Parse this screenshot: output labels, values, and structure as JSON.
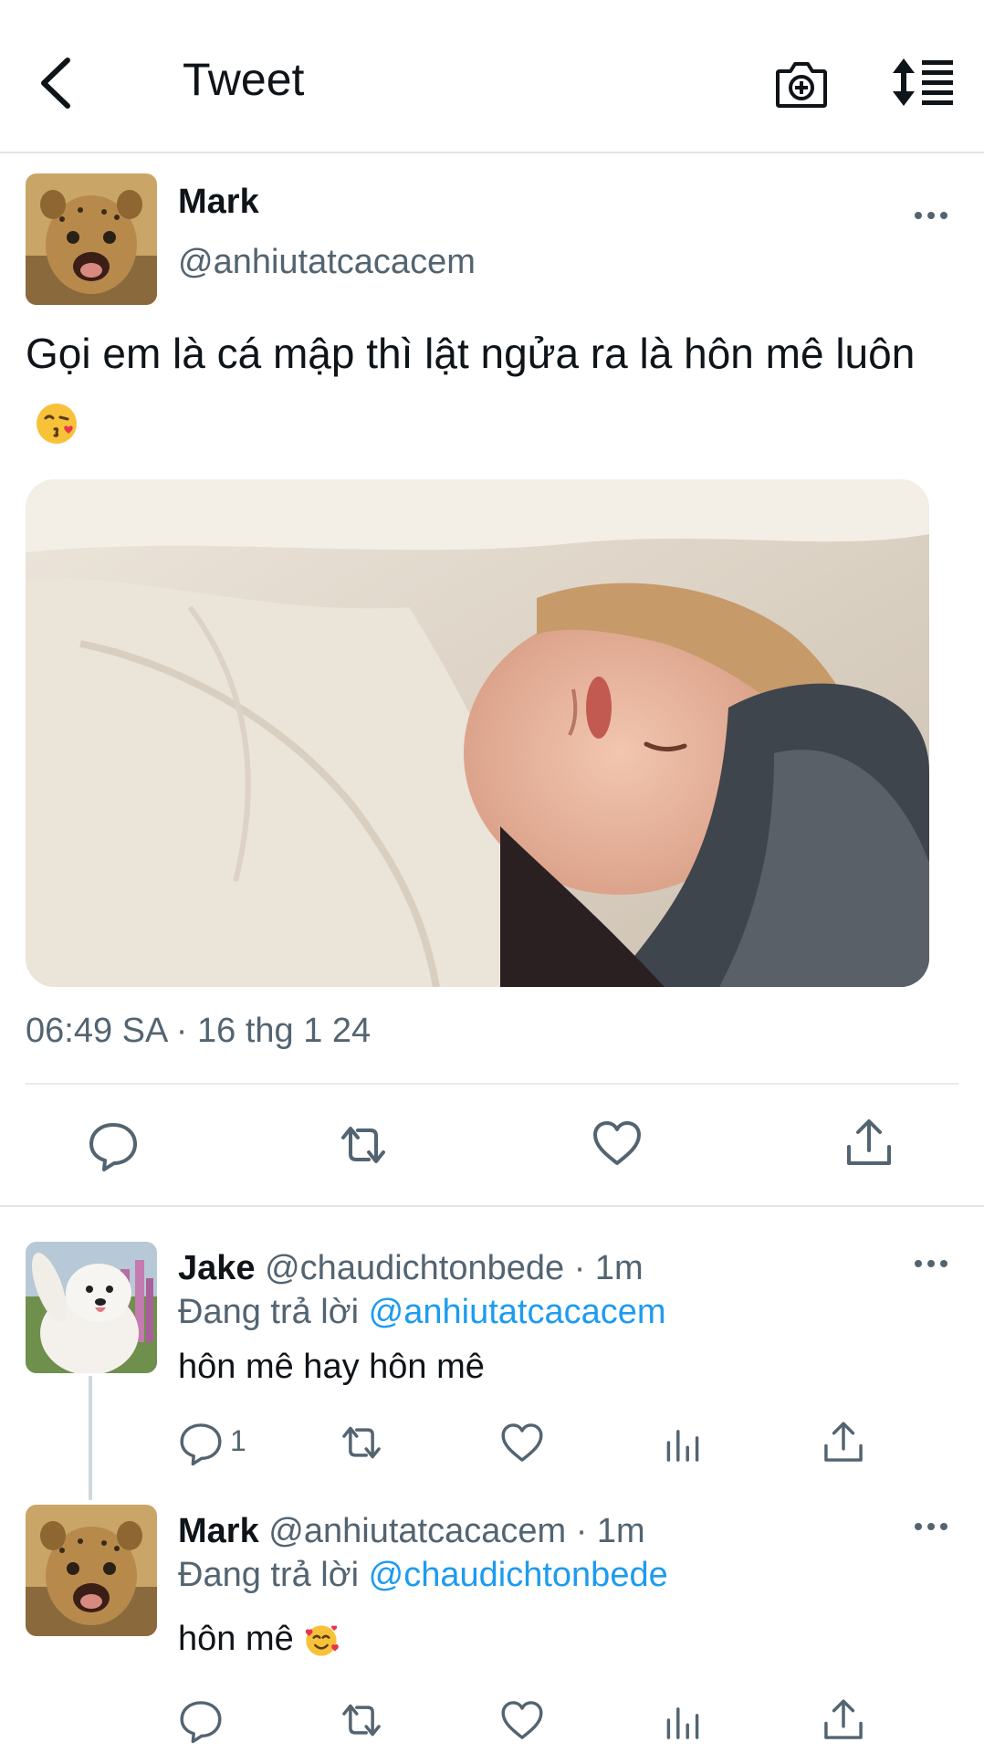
{
  "header": {
    "title": "Tweet",
    "back_icon": "back-arrow-icon",
    "camera_icon": "camera-add-icon",
    "sort_icon": "sort-icon"
  },
  "main_tweet": {
    "name": "Mark",
    "handle": "@anhiutatcacacem",
    "text": "Gọi em là cá mập thì lật ngửa ra là hôn mê luôn",
    "emoji": "face-blowing-kiss",
    "timestamp": "06:49 SA · 16 thg 1 24",
    "actions": [
      "reply",
      "retweet",
      "like",
      "share"
    ]
  },
  "replies": [
    {
      "name": "Jake",
      "meta": "@chaudichtonbede · 1m",
      "replying_prefix": "Đang trả lời ",
      "replying_to": "@anhiutatcacacem",
      "text": "hôn mê hay hôn mê",
      "reply_count": "1"
    },
    {
      "name": "Mark",
      "meta": "@anhiutatcacacem · 1m",
      "replying_prefix": "Đang trả lời ",
      "replying_to": "@chaudichtonbede",
      "text": "hôn mê",
      "emoji": "smiling-face-with-hearts"
    }
  ],
  "colors": {
    "text": "#0f1419",
    "secondary": "#536471",
    "link": "#1d9bf0",
    "divider": "#e1e5e8"
  }
}
